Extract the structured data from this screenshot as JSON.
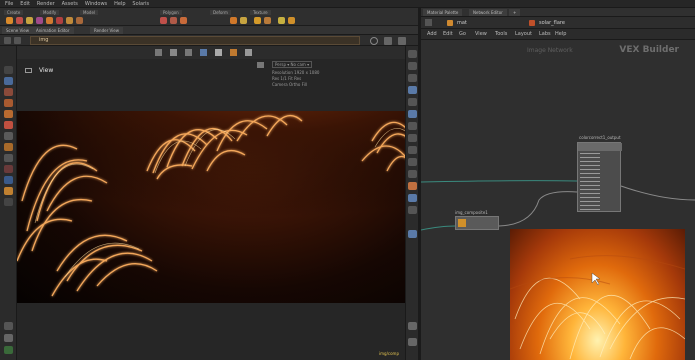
{
  "menubar": {
    "items": [
      "File",
      "Edit",
      "Render",
      "Assets",
      "Windows",
      "Help",
      "Solaris"
    ]
  },
  "shelf": {
    "tabs": [
      "Create",
      "Modify",
      "Model",
      "Polygon",
      "Deform",
      "Texture"
    ]
  },
  "left_pane": {
    "tabs": [
      "Scene View",
      "Animation Editor",
      "Render View"
    ],
    "path": "img",
    "viewport_label": "View",
    "info_lines": [
      "Persp ▾ No cam ▾",
      "Resolution 1920 x 1080",
      "Res 1/1 Fit Res",
      "Camera Ortho Fill"
    ],
    "status": "img/comp"
  },
  "right_pane": {
    "tabs": [
      "Material Palette",
      "Network Editor",
      "+"
    ],
    "path_items": [
      "mat",
      "solar_flare"
    ],
    "menu": [
      "Add",
      "Edit",
      "Go",
      "View",
      "Tools",
      "Layout",
      "Labs",
      "Help"
    ],
    "context": "Image Network",
    "title": "VEX Builder",
    "nodes": [
      {
        "label": "colorcorrect1_output"
      },
      {
        "label": "img_composite1"
      }
    ]
  },
  "colors": {
    "accent": "#e0a050",
    "viewport_glow": "#ff9a3a",
    "wire": "#3a8a7e"
  }
}
